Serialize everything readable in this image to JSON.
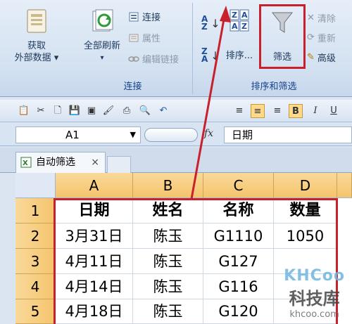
{
  "ribbon": {
    "get_data": {
      "line1": "获取",
      "line2": "外部数据 ▾"
    },
    "refresh_all": {
      "label": "全部刷新",
      "arrow": "▾"
    },
    "connections": {
      "label": "连接"
    },
    "properties": {
      "label": "属性"
    },
    "edit_links": {
      "label": "编辑链接"
    },
    "connections_group": "连接",
    "sort_button": "排序...",
    "filter_button": "筛选",
    "clear": "清除",
    "reapply": "重新",
    "advanced": "高级",
    "sort_filter_group": "排序和筛选"
  },
  "formula_bar": {
    "name_box": "A1",
    "fx": "fx",
    "content": "日期"
  },
  "sheet_tab": {
    "label": "自动筛选",
    "close": "×"
  },
  "columns": [
    "A",
    "B",
    "C",
    "D"
  ],
  "rows": [
    "1",
    "2",
    "3",
    "4",
    "5"
  ],
  "cells": [
    [
      "日期",
      "姓名",
      "名称",
      "数量"
    ],
    [
      "3月31日",
      "陈玉",
      "G1110",
      "1050"
    ],
    [
      "4月11日",
      "陈玉",
      "G127",
      ""
    ],
    [
      "4月14日",
      "陈玉",
      "G116",
      ""
    ],
    [
      "4月18日",
      "陈玉",
      "G120",
      ""
    ]
  ],
  "watermark": {
    "logo": "KHCoo",
    "name": "科技库",
    "url": "khcoo.com"
  },
  "colors": {
    "annotation_red": "#c8202c",
    "header_orange": "#f5c46b",
    "ribbon_blue": "#d3e1f1"
  }
}
